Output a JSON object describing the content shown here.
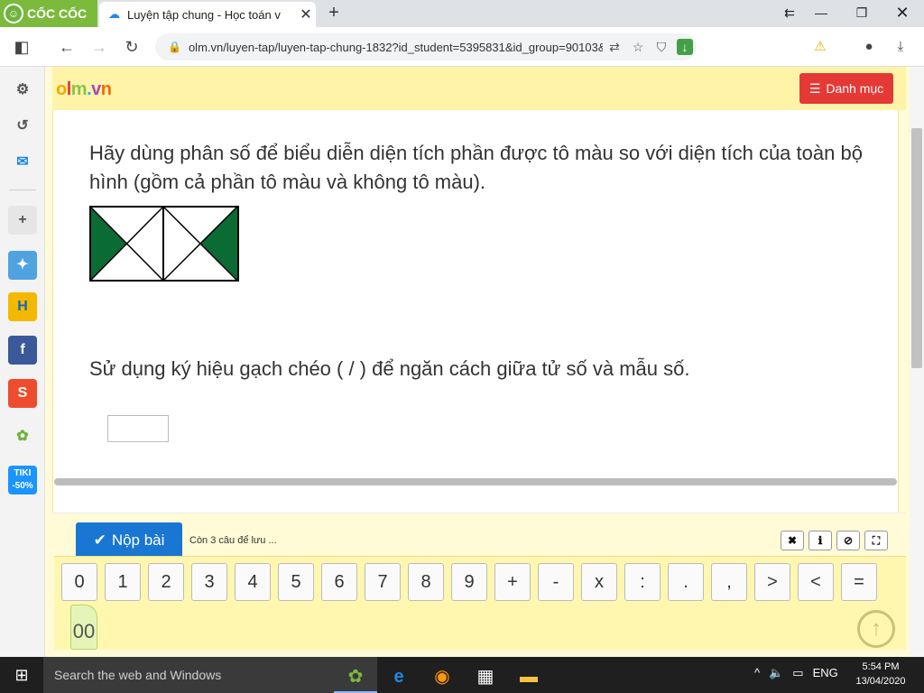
{
  "browser": {
    "brand": "CỐC CỐC",
    "tab_title": "Luyện tập chung - Học toán v",
    "url": "olm.vn/luyen-tap/luyen-tap-chung-1832?id_student=5395831&id_group=90103&i..."
  },
  "site": {
    "logo": {
      "o": "o",
      "l": "l",
      "m": "m",
      "dot": ".",
      "v": "v",
      "n": "n"
    },
    "menu_label": "Danh mục"
  },
  "question": {
    "text": "Hãy dùng phân số để biểu diễn diện tích phần được tô màu so với diện tích của toàn bộ hình (gồm cả phần tô màu và không tô màu).",
    "instruction": "Sử dụng ký hiệu gạch chéo ( / ) để ngăn cách giữa tử số và mẫu số.",
    "answer_value": "",
    "shade_color": "#0b6b34"
  },
  "actions": {
    "submit_label": "Nộp bài",
    "remaining": "Còn 3 câu để lưu ..."
  },
  "keypad": {
    "keys": [
      "0",
      "1",
      "2",
      "3",
      "4",
      "5",
      "6",
      "7",
      "8",
      "9",
      "+",
      "-",
      "x",
      ":",
      ".",
      ",",
      ">",
      "<",
      "="
    ],
    "extra_key": "00"
  },
  "taskbar": {
    "search_placeholder": "Search the web and Windows",
    "language": "ENG",
    "time": "5:54 PM",
    "date": "13/04/2020"
  },
  "colors": {
    "accent_red": "#e53935",
    "accent_blue": "#1976d2"
  }
}
